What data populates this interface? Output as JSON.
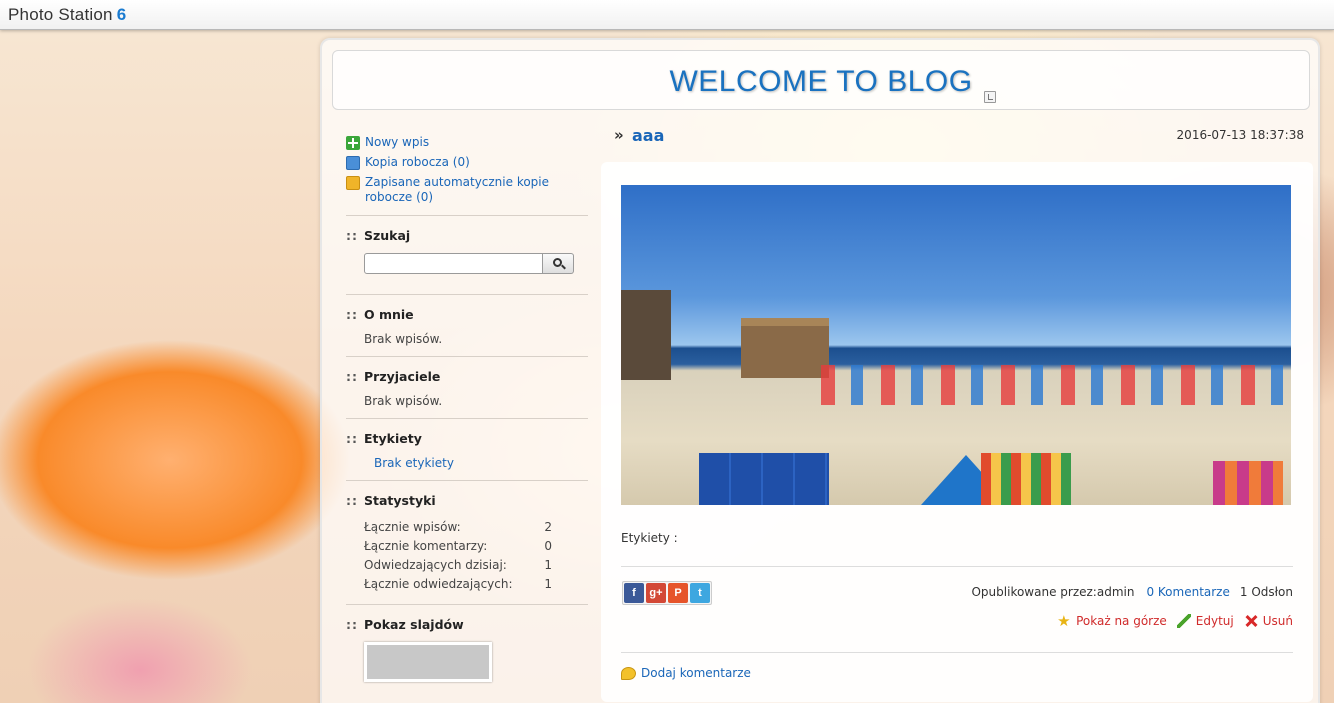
{
  "app": {
    "title": "Photo Station",
    "version": "6"
  },
  "blog": {
    "title": "WELCOME TO BLOG"
  },
  "sidebar": {
    "links": [
      {
        "label": "Nowy wpis",
        "icon": "add-icon"
      },
      {
        "label": "Kopia robocza (0)",
        "icon": "draft-icon"
      },
      {
        "label": "Zapisane automatycznie kopie robocze (0)",
        "icon": "folder-icon"
      }
    ],
    "search": {
      "title": "Szukaj",
      "value": "",
      "placeholder": ""
    },
    "about": {
      "title": "O mnie",
      "text": "Brak wpisów."
    },
    "friends": {
      "title": "Przyjaciele",
      "text": "Brak wpisów."
    },
    "tags": {
      "title": "Etykiety",
      "link": "Brak etykiety"
    },
    "stats": {
      "title": "Statystyki",
      "rows": [
        {
          "label": "Łącznie wpisów:",
          "value": "2"
        },
        {
          "label": "Łącznie komentarzy:",
          "value": "0"
        },
        {
          "label": "Odwiedzających dzisiaj:",
          "value": "1"
        },
        {
          "label": "Łącznie odwiedzających:",
          "value": "1"
        }
      ]
    },
    "slideshow": {
      "title": "Pokaz slajdów"
    }
  },
  "post": {
    "title": "aaa",
    "date": "2016-07-13 18:37:38",
    "tags_label": "Etykiety :",
    "published_by": "Opublikowane przez:admin",
    "comments_link": "0 Komentarze",
    "views": "1 Odsłon",
    "actions": {
      "top": "Pokaż na górze",
      "edit": "Edytuj",
      "delete": "Usuń"
    },
    "add_comment": "Dodaj komentarze",
    "share": {
      "facebook": "f",
      "google": "g+",
      "plurk": "P",
      "twitter": "t"
    }
  },
  "colors": {
    "accent": "#1a72c0",
    "link": "#1a66b8",
    "danger": "#d02b2b"
  }
}
